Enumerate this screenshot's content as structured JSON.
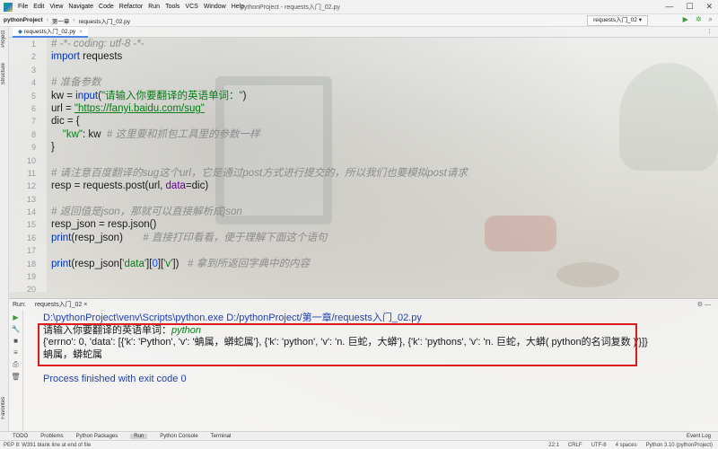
{
  "window": {
    "title": "pythonProject - requests入门_02.py",
    "menu": [
      "File",
      "Edit",
      "View",
      "Navigate",
      "Code",
      "Refactor",
      "Run",
      "Tools",
      "VCS",
      "Window",
      "Help"
    ],
    "controls": [
      "—",
      "☐",
      "✕"
    ]
  },
  "nav": {
    "project": "pythonProject",
    "folder": "第一章",
    "file": "requests入门_02.py",
    "run_config": "requests入门_02 ▾"
  },
  "left_tool_tabs": [
    "Project",
    "Structure",
    "Favorites"
  ],
  "editor": {
    "tab_label": "requests入门_02.py",
    "tab_close": "×",
    "line_numbers": [
      "1",
      "2",
      "3",
      "4",
      "5",
      "6",
      "7",
      "8",
      "9",
      "10",
      "11",
      "12",
      "13",
      "14",
      "15",
      "16",
      "17",
      "18",
      "19",
      "20"
    ],
    "lines": [
      {
        "parts": [
          {
            "t": "# -*- coding: utf-8 -*-",
            "c": "cm"
          }
        ]
      },
      {
        "parts": [
          {
            "t": "import ",
            "c": "kw"
          },
          {
            "t": "requests",
            "c": ""
          }
        ]
      },
      {
        "parts": [
          {
            "t": "",
            "c": ""
          }
        ]
      },
      {
        "parts": [
          {
            "t": "# 准备参数",
            "c": "cm"
          }
        ]
      },
      {
        "parts": [
          {
            "t": "kw = ",
            "c": ""
          },
          {
            "t": "input",
            "c": "fn"
          },
          {
            "t": "(",
            "c": ""
          },
          {
            "t": "\"请输入你要翻译的英语单词：\"",
            "c": "str"
          },
          {
            "t": ")",
            "c": ""
          }
        ]
      },
      {
        "parts": [
          {
            "t": "url = ",
            "c": ""
          },
          {
            "t": "\"https://fanyi.baidu.com/sug\"",
            "c": "url"
          }
        ]
      },
      {
        "parts": [
          {
            "t": "dic = {",
            "c": ""
          }
        ]
      },
      {
        "parts": [
          {
            "t": "    ",
            "c": ""
          },
          {
            "t": "\"kw\"",
            "c": "str"
          },
          {
            "t": ": kw  ",
            "c": ""
          },
          {
            "t": "# 这里要和抓包工具里的参数一样",
            "c": "cm"
          }
        ]
      },
      {
        "parts": [
          {
            "t": "}",
            "c": ""
          }
        ]
      },
      {
        "parts": [
          {
            "t": "",
            "c": ""
          }
        ]
      },
      {
        "parts": [
          {
            "t": "# 请注意百度翻译的sug这个url，它是通过post方式进行提交的，所以我们也要模拟post请求",
            "c": "cm"
          }
        ]
      },
      {
        "parts": [
          {
            "t": "resp = requests.post(url, ",
            "c": ""
          },
          {
            "t": "data",
            "c": "param"
          },
          {
            "t": "=dic)",
            "c": ""
          }
        ]
      },
      {
        "parts": [
          {
            "t": "",
            "c": ""
          }
        ]
      },
      {
        "parts": [
          {
            "t": "# 返回值是json，那就可以直接解析成json",
            "c": "cm"
          }
        ]
      },
      {
        "parts": [
          {
            "t": "resp_json = resp.json()",
            "c": ""
          }
        ]
      },
      {
        "parts": [
          {
            "t": "print",
            "c": "fn"
          },
          {
            "t": "(resp_json)       ",
            "c": ""
          },
          {
            "t": "# 直接打印看看，便于理解下面这个语句",
            "c": "cm"
          }
        ]
      },
      {
        "parts": [
          {
            "t": "",
            "c": ""
          }
        ]
      },
      {
        "parts": [
          {
            "t": "print",
            "c": "fn"
          },
          {
            "t": "(resp_json[",
            "c": ""
          },
          {
            "t": "'data'",
            "c": "str"
          },
          {
            "t": "][",
            "c": ""
          },
          {
            "t": "0",
            "c": "num"
          },
          {
            "t": "][",
            "c": ""
          },
          {
            "t": "'v'",
            "c": "str"
          },
          {
            "t": "])   ",
            "c": ""
          },
          {
            "t": "# 拿到所返回字典中的内容",
            "c": "cm"
          }
        ]
      },
      {
        "parts": [
          {
            "t": "",
            "c": ""
          }
        ]
      },
      {
        "parts": [
          {
            "t": "",
            "c": ""
          }
        ]
      }
    ]
  },
  "run_panel": {
    "label": "Run:",
    "tab": "requests入门_02 ×",
    "actions": "⚙ —",
    "console": {
      "command": "D:\\pythonProject\\venv\\Scripts\\python.exe D:/pythonProject/第一章/requests入门_02.py",
      "prompt": "请输入你要翻译的英语单词：",
      "user_input": "python",
      "result": "{'errno': 0, 'data': [{'k': 'Python', 'v': '蚺属，蟒蛇属'}, {'k': 'python', 'v': 'n. 巨蛇，大蟒'}, {'k': 'pythons', 'v': 'n. 巨蛇，大蟒( python的名词复数 )'}]}",
      "value": "蚺属，蟒蛇属",
      "finished": "Process finished with exit code 0"
    }
  },
  "tool_windows": [
    "TODO",
    "Problems",
    "Python Packages",
    "Run",
    "Python Console",
    "Terminal"
  ],
  "event_log": "Event Log",
  "status": {
    "message": "PEP 8: W391 blank line at end of file",
    "position": "22:1",
    "line_sep": "CRLF",
    "encoding": "UTF-8",
    "indent": "4 spaces",
    "interpreter": "Python 3.10 (pythonProject)"
  }
}
